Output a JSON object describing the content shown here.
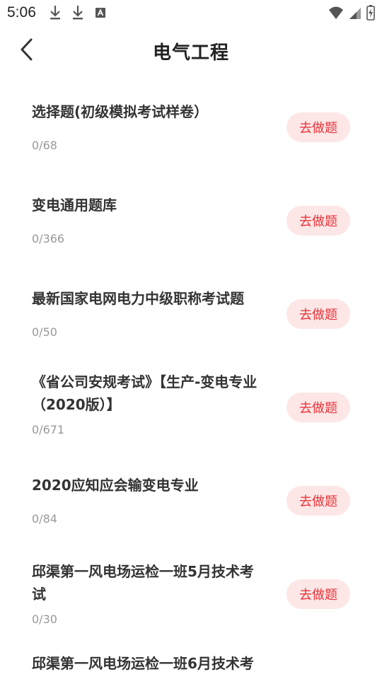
{
  "status_bar": {
    "time": "5:06",
    "left_icons": [
      "download-icon",
      "download-icon",
      "text-a-icon"
    ],
    "right_icons": [
      "wifi-icon",
      "signal-icon",
      "battery-icon"
    ]
  },
  "header": {
    "title": "电气工程",
    "back_icon": "chevron-left-icon"
  },
  "colors": {
    "accent": "#e8343a",
    "button_bg": "#fde6e6",
    "text_primary": "#333333",
    "text_secondary": "#999999"
  },
  "items": [
    {
      "title": "选择题(初级模拟考试样卷）",
      "progress": "0/68",
      "button": "去做题"
    },
    {
      "title": "变电通用题库",
      "progress": "0/366",
      "button": "去做题"
    },
    {
      "title": "最新国家电网电力中级职称考试题",
      "progress": "0/50",
      "button": "去做题"
    },
    {
      "title": "《省公司安规考试》【生产-变电专业（2020版）】",
      "progress": "0/671",
      "button": "去做题"
    },
    {
      "title": "2020应知应会输变电专业",
      "progress": "0/84",
      "button": "去做题"
    },
    {
      "title": "邱渠第一风电场运检一班5月技术考试",
      "progress": "0/30",
      "button": "去做题"
    },
    {
      "title": "邱渠第一风电场运检一班6月技术考",
      "progress": "",
      "button": ""
    }
  ]
}
